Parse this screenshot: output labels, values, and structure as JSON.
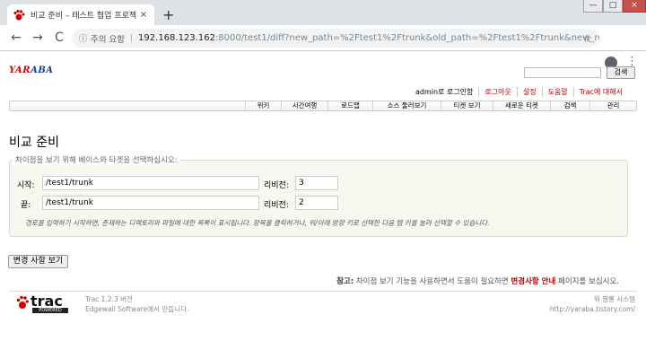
{
  "browser": {
    "tab_title": "비교 준비 – 테스트 협업 프로젝",
    "tab_close": "×",
    "new_tab": "+",
    "window_controls": {
      "minimize": "—",
      "maximize": "□",
      "close": "×"
    },
    "nav": {
      "back": "←",
      "forward": "→",
      "reload": "C"
    },
    "security_label": "주의 요함",
    "url_host": "192.168.123.162",
    "url_rest": ":8000/test1/diff?new_path=%2Ftest1%2Ftrunk&old_path=%2Ftest1%2Ftrunk&new_rev=&old...",
    "star": "☆",
    "menu": "⋮"
  },
  "site": {
    "logo_a": "YAR",
    "logo_b": "ABA",
    "search_button": "검색",
    "search_value": ""
  },
  "metanav": {
    "user": "admin로 로그인함",
    "logout": "로그아웃",
    "settings": "설정",
    "help": "도움말",
    "about": "Trac에 대해서"
  },
  "mainnav": [
    {
      "label": "위키"
    },
    {
      "label": "시간여행"
    },
    {
      "label": "로드맵"
    },
    {
      "label": "소스 둘러보기"
    },
    {
      "label": "티켓 보기"
    },
    {
      "label": "새로운 티켓"
    },
    {
      "label": "검색"
    },
    {
      "label": "관리"
    }
  ],
  "page": {
    "title": "비교 준비",
    "legend": "차이점을 보기 위해 베이스와 타겟을 선택하십시오:",
    "from_label": "시작:",
    "from_path": "/test1/trunk",
    "from_rev_label": "리비전:",
    "from_rev": "3",
    "to_label": "끝:",
    "to_path": "/test1/trunk",
    "to_rev_label": "리비전:",
    "to_rev": "2",
    "hint": "경로를 입력하기 시작하면, 존재하는 디렉토리와 파일에 대한 목록이 표시됩니다. 항목을 클릭하거나, 위/아래 방향 키로 선택한 다음 탭 키를 눌러 선택할 수 있습니다.",
    "view_button": "변경 사항 보기",
    "note_prefix": "참고:",
    "note_text": "차이점 보기 기능을 사용하면서 도움이 필요하면",
    "note_link": "변경사항 안내",
    "note_suffix": "페이지를 보십시오."
  },
  "footer": {
    "trac_text": "trac",
    "powered": "POWERED",
    "version": "Trac 1.2.3 버전",
    "by": "Edgewall Software에서 만듭니다.",
    "site_name": "뭐 짬뽕 사스템",
    "site_url": "http://yaraba.tistory.com/"
  },
  "colors": {
    "link": "#b00000",
    "accent": "#c00000"
  }
}
